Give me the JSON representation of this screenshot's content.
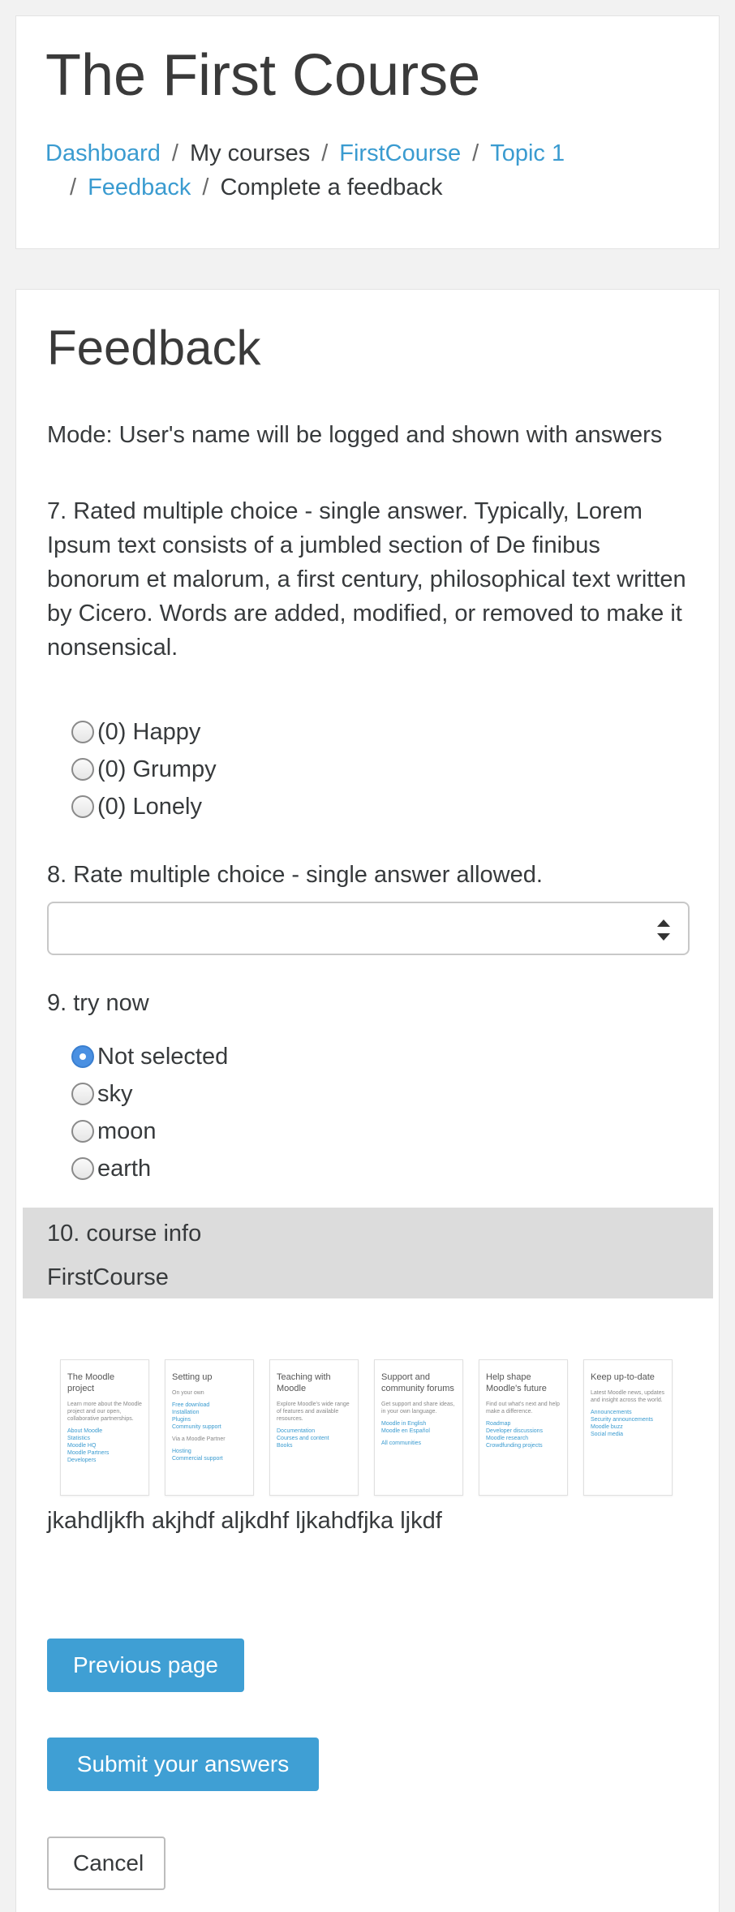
{
  "header": {
    "course_title": "The First Course",
    "breadcrumb": {
      "dashboard": "Dashboard",
      "my_courses": "My courses",
      "course": "FirstCourse",
      "topic": "Topic 1",
      "feedback": "Feedback",
      "current": "Complete a feedback",
      "separator": "/"
    }
  },
  "main": {
    "heading": "Feedback",
    "mode": "Mode: User's name will be logged and shown with answers",
    "q7": {
      "text": "7. Rated multiple choice - single answer. Typically, Lorem Ipsum text consists of a jumbled section of De finibus bonorum et malorum, a first century, philosophical text written by Cicero. Words are added, modified, or removed to make it nonsensical.",
      "options": [
        "(0) Happy",
        "(0) Grumpy",
        "(0) Lonely"
      ]
    },
    "q8": {
      "text": "8. Rate multiple choice - single answer allowed.",
      "selected": ""
    },
    "q9": {
      "text": "9. try now",
      "options": [
        "Not selected",
        "sky",
        "moon",
        "earth"
      ],
      "selected_index": 0
    },
    "q10": {
      "text": "10. course info",
      "value": "FirstCourse"
    },
    "thumbnails": [
      {
        "title": "The Moodle project",
        "text": "Learn more about the Moodle project and our open, collaborative partnerships.",
        "links": [
          "About Moodle",
          "Statistics",
          "Moodle HQ",
          "Moodle Partners",
          "Developers"
        ]
      },
      {
        "title": "Setting up",
        "text": "On your own",
        "links": [
          "Free download",
          "Installation",
          "Plugins",
          "Community support"
        ],
        "text2": "Via a Moodle Partner",
        "links2": [
          "Hosting",
          "Commercial support"
        ]
      },
      {
        "title": "Teaching with Moodle",
        "text": "Explore Moodle's wide range of features and available resources.",
        "links": [
          "Documentation",
          "Courses and content",
          "Books"
        ]
      },
      {
        "title": "Support and community forums",
        "text": "Get support and share ideas, in your own language.",
        "links": [
          "Moodle in English",
          "Moodle en Español"
        ],
        "links2": [
          "All communities"
        ]
      },
      {
        "title": "Help shape Moodle's future",
        "text": "Find out what's next and help make a difference.",
        "links": [
          "Roadmap",
          "Developer discussions",
          "Moodle research",
          "Crowdfunding projects"
        ]
      },
      {
        "title": "Keep up-to-date",
        "text": "Latest Moodle news, updates and insight across the world.",
        "links": [
          "Announcements",
          "Security announcements",
          "Moodle buzz",
          "Social media"
        ]
      }
    ],
    "label_text": "jkahdljkfh akjhdf aljkdhf ljkahdfjka ljkdf",
    "buttons": {
      "previous": "Previous page",
      "submit": "Submit your answers",
      "cancel": "Cancel"
    }
  }
}
